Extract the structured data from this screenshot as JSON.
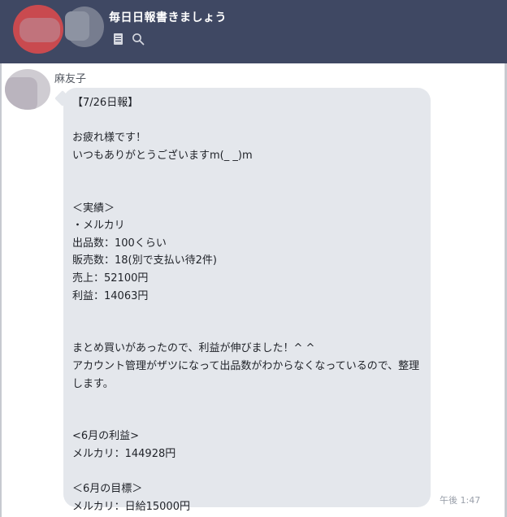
{
  "header": {
    "title": "毎日日報書きましょう"
  },
  "message": {
    "sender": "麻友子",
    "text": "【7/26日報】\n\nお疲れ様です！\nいつもありがとうございますm(_ _)m\n\n\n＜実績＞\n・メルカリ\n出品数：100くらい\n販売数：18(別で支払い待2件)\n売上：52100円\n利益：14063円\n\n\nまとめ買いがあったので、利益が伸びました！^ ^\nアカウント管理がザツになって出品数がわからなくなっているので、整理します。\n\n\n<6月の利益>\nメルカリ：144928円\n\n＜6月の目標＞\nメルカリ：日給15000円",
    "time": "午後 1:47"
  },
  "colors": {
    "header_bg": "#3f4863",
    "bubble_bg": "#e4e7ec"
  }
}
